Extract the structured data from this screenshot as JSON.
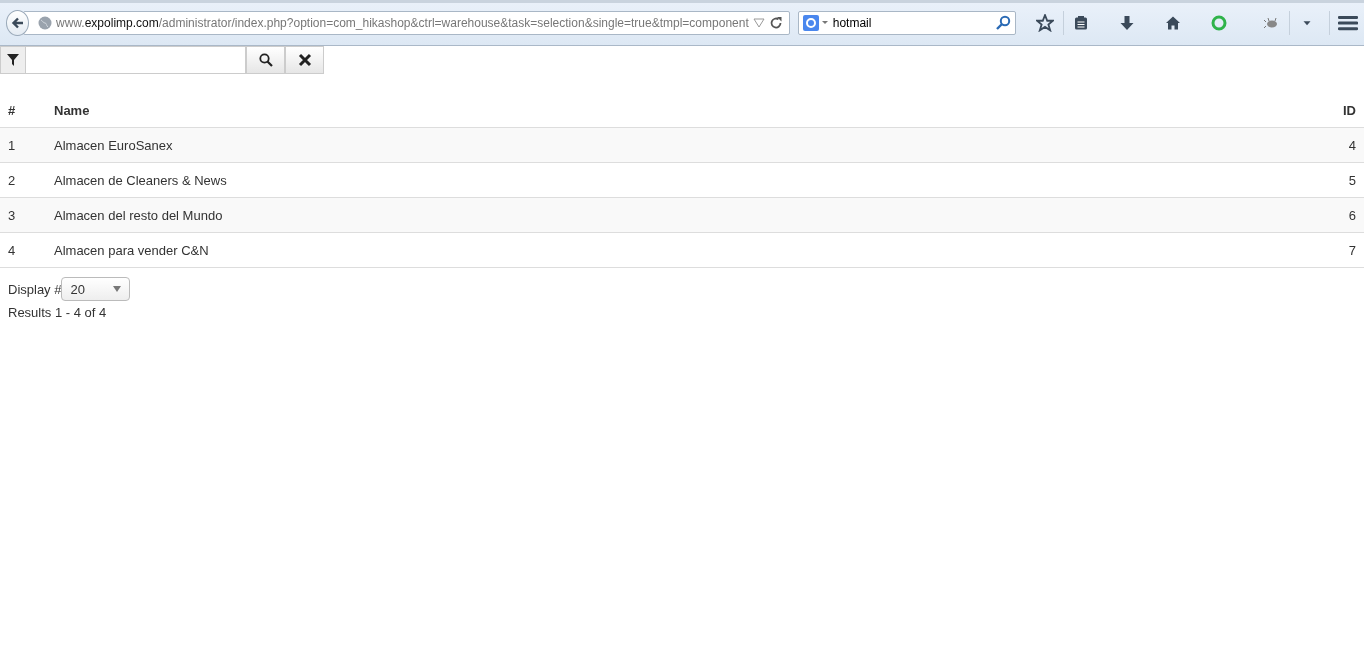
{
  "browser": {
    "url": {
      "prefix": "www.",
      "domain": "expolimp.com",
      "path": "/administrator/index.php?option=com_hikashop&ctrl=warehouse&task=selection&single=true&tmpl=component"
    },
    "search": {
      "value": "hotmail"
    }
  },
  "table": {
    "columns": [
      "#",
      "Name",
      "ID"
    ],
    "rows": [
      [
        "1",
        "Almacen EuroSanex",
        "4"
      ],
      [
        "2",
        "Almacen de Cleaners & News",
        "5"
      ],
      [
        "3",
        "Almacen del resto del Mundo",
        "6"
      ],
      [
        "4",
        "Almacen para vender C&N",
        "7"
      ]
    ]
  },
  "pagination": {
    "label": "Display #",
    "value": "20",
    "results": "Results 1 - 4 of 4"
  }
}
